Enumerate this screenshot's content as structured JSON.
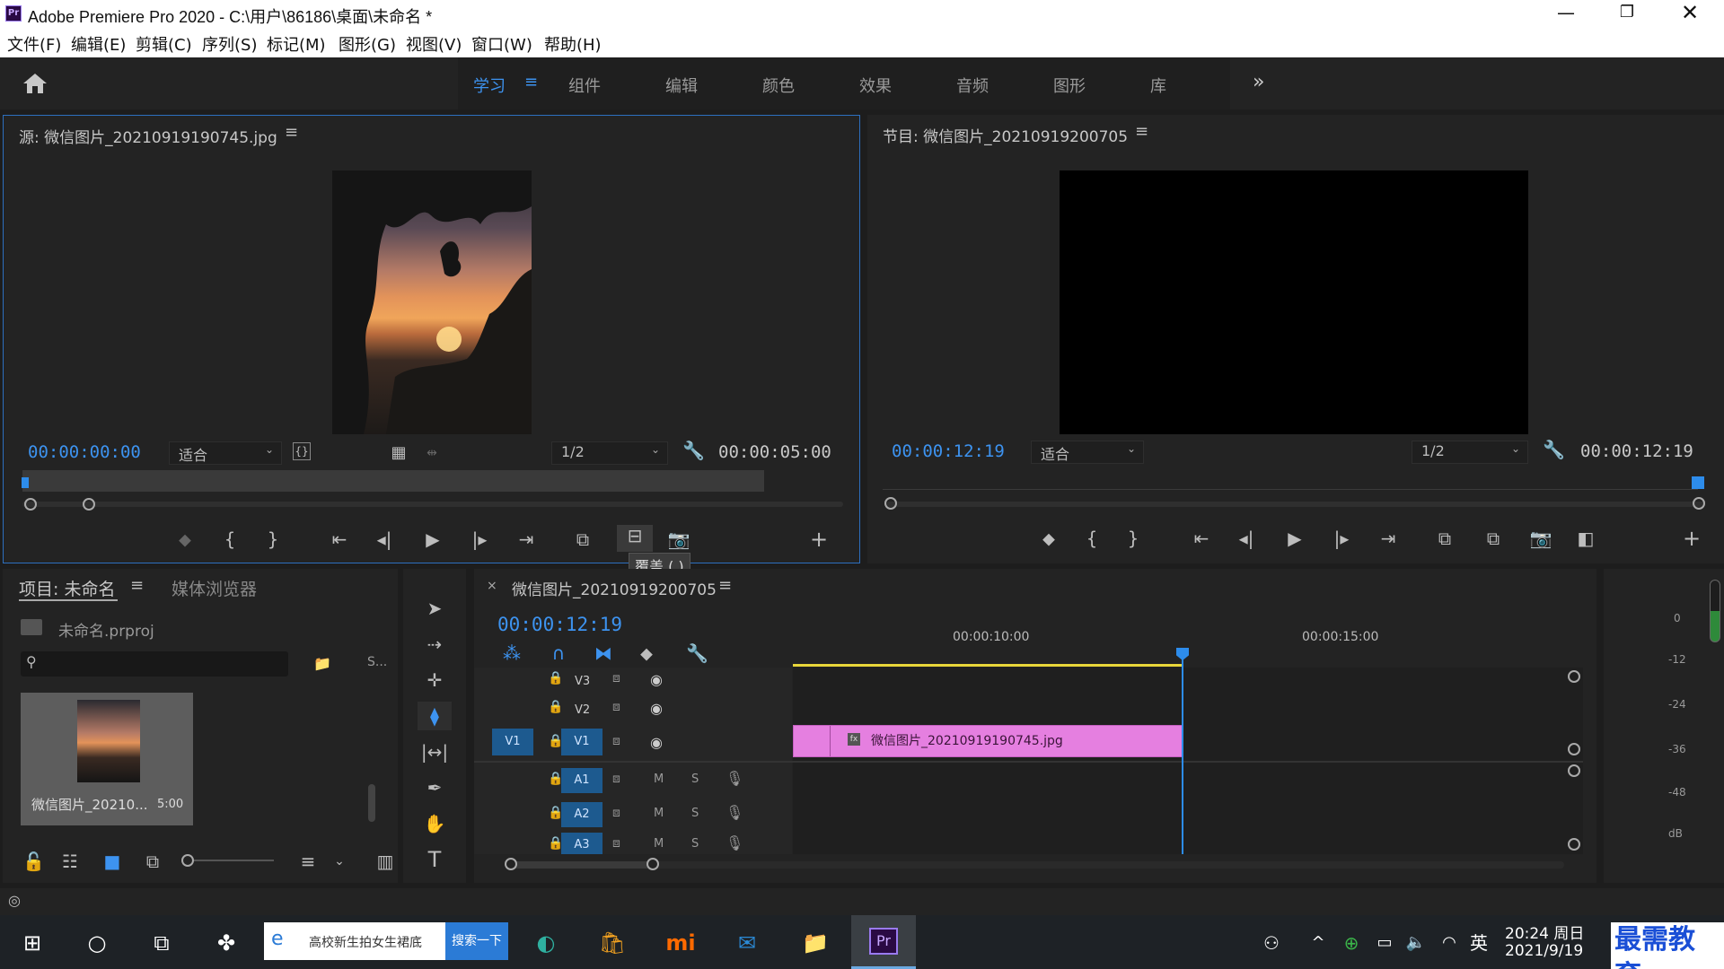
{
  "window": {
    "title": "Adobe Premiere Pro 2020 - C:\\用户\\86186\\桌面\\未命名 *",
    "app_icon": "Pr"
  },
  "menu": [
    "文件(F)",
    "编辑(E)",
    "剪辑(C)",
    "序列(S)",
    "标记(M)",
    "图形(G)",
    "视图(V)",
    "窗口(W)",
    "帮助(H)"
  ],
  "workspaces": [
    "学习",
    "组件",
    "编辑",
    "颜色",
    "效果",
    "音频",
    "图形",
    "库"
  ],
  "source": {
    "title": "源: 微信图片_20210919190745.jpg",
    "timecode": "00:00:00:00",
    "fit": "适合",
    "resolution": "1/2",
    "duration": "00:00:05:00",
    "tooltip": "覆盖 (.)"
  },
  "program": {
    "title": "节目: 微信图片_20210919200705",
    "timecode": "00:00:12:19",
    "fit": "适合",
    "resolution": "1/2",
    "duration": "00:00:12:19"
  },
  "project": {
    "tab_project": "项目: 未命名",
    "tab_media": "媒体浏览器",
    "file": "未命名.prproj",
    "search_placeholder": "",
    "extra": "S...",
    "clip_name": "微信图片_20210...",
    "clip_duration": "5:00"
  },
  "timeline": {
    "title": "微信图片_20210919200705",
    "timecode": "00:00:12:19",
    "ruler": [
      "00:00:10:00",
      "00:00:15:00"
    ],
    "tracks": {
      "v3": "V3",
      "v2": "V2",
      "v1": "V1",
      "source_v1": "V1",
      "a1": "A1",
      "a2": "A2",
      "a3": "A3",
      "m": "M",
      "s": "S"
    },
    "clip_label": "微信图片_20210919190745.jpg",
    "clip_color": "#e57fe0"
  },
  "meter": {
    "labels": [
      "0",
      "-12",
      "-24",
      "-36",
      "-48",
      "dB"
    ]
  },
  "taskbar": {
    "search_text": "高校新生拍女生裙底",
    "search_button": "搜索一下",
    "time": "20:24 周日",
    "date": "2021/9/19",
    "ime": "英",
    "watermark": "最需教育"
  },
  "colors": {
    "accent": "#3d93f0",
    "playhead": "#2d8ceb",
    "clip": "#e57fe0",
    "work_area": "#e8d63a"
  }
}
